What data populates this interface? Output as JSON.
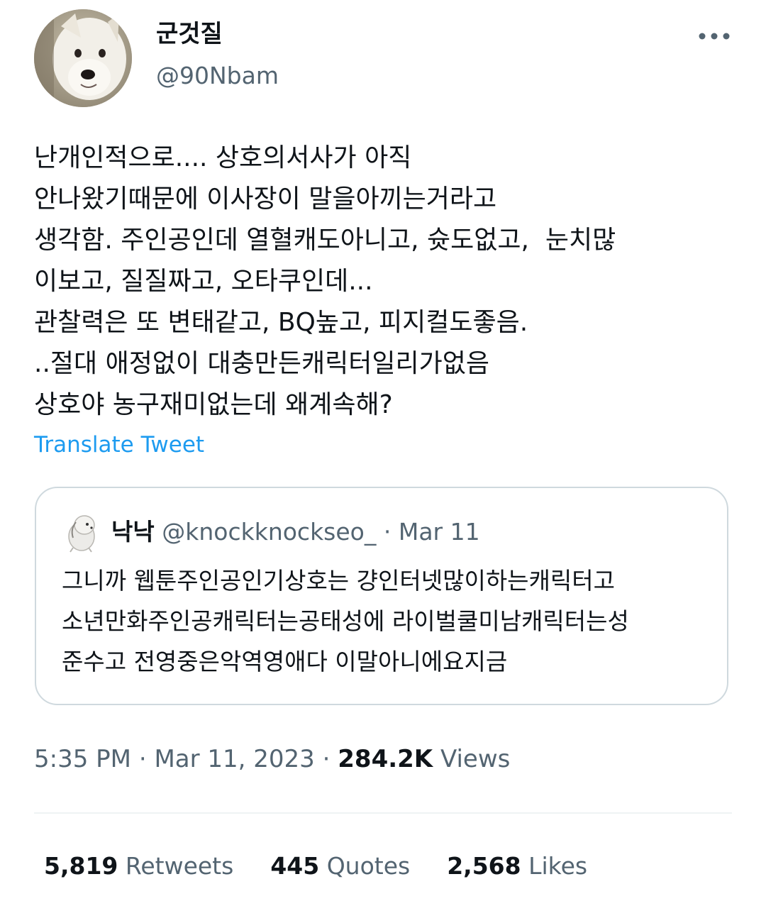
{
  "author": {
    "display_name": "군것질",
    "handle": "@90Nbam",
    "avatar_icon": "white-dog-avatar"
  },
  "more_icon": "more-options-icon",
  "tweet": {
    "text": "난개인적으로.... 상호의서사가 아직\n안나왔기때문에 이사장이 말을아끼는거라고\n생각함. 주인공인데 열혈캐도아니고, 슛도없고,  눈치많\n이보고, 질질짜고, 오타쿠인데...\n관찰력은 또 변태같고, BQ높고, 피지컬도좋음.\n..절대 애정없이 대충만든캐릭터일리가없음\n상호야 농구재미없는데 왜계속해?",
    "translate_label": "Translate Tweet"
  },
  "quoted_tweet": {
    "display_name": "낙낙",
    "handle": "@knockknockseo_",
    "separator": "·",
    "date": "Mar 11",
    "avatar_icon": "white-puppy-avatar",
    "text": "그니까 웹툰주인공인기상호는 걍인터넷많이하는캐릭터고\n소년만화주인공캐릭터는공태성에 라이벌쿨미남캐릭터는성\n준수고 전영중은악역영애다 이말아니에요지금"
  },
  "meta": {
    "time": "5:35 PM",
    "separator1": "·",
    "date": "Mar 11, 2023",
    "separator2": "·",
    "views_count": "284.2K",
    "views_label": "Views"
  },
  "stats": {
    "retweets_count": "5,819",
    "retweets_label": "Retweets",
    "quotes_count": "445",
    "quotes_label": "Quotes",
    "likes_count": "2,568",
    "likes_label": "Likes"
  },
  "colors": {
    "link": "#1d9bf0",
    "muted": "#536471",
    "text": "#0f1419",
    "border": "#cfd9de"
  }
}
